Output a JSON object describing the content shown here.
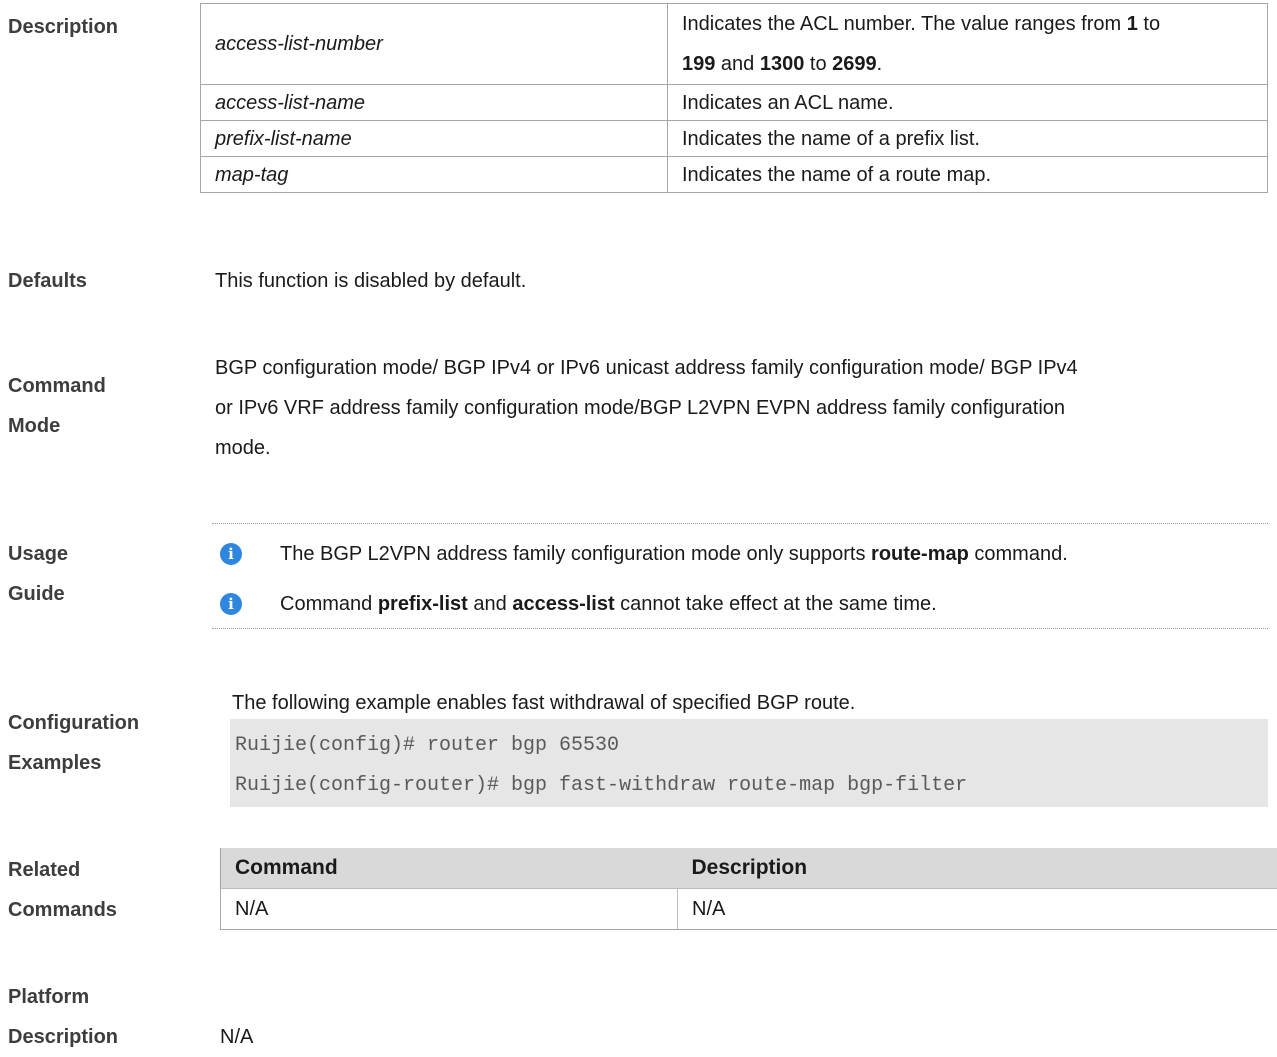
{
  "sections": {
    "description": "Description",
    "defaults": "Defaults",
    "command_mode_1": "Command",
    "command_mode_2": "Mode",
    "usage_1": "Usage",
    "usage_2": "Guide",
    "config_1": "Configuration",
    "config_2": "Examples",
    "related_1": "Related",
    "related_2": "Commands",
    "platform_1": "Platform",
    "platform_2": "Description"
  },
  "params": [
    {
      "name": "access-list-number",
      "desc_pre": "Indicates the ACL number. The value ranges from ",
      "v1": "1",
      "t1": " to",
      "v2": "199",
      "t2": " and ",
      "v3": "1300",
      "t3": " to ",
      "v4": "2699",
      "t4": "."
    },
    {
      "name": "access-list-name",
      "desc": "Indicates an ACL name."
    },
    {
      "name": "prefix-list-name",
      "desc": "Indicates the name of a prefix list."
    },
    {
      "name": "map-tag",
      "desc": "Indicates the name of a route map."
    }
  ],
  "defaults": "This function is disabled by default.",
  "command_mode": {
    "line1": "BGP configuration mode/ BGP IPv4 or IPv6 unicast address family configuration mode/ BGP IPv4",
    "line2": "or IPv6 VRF address family configuration mode/BGP L2VPN EVPN address family configuration",
    "line3": "mode."
  },
  "usage": {
    "note1_pre": "The BGP L2VPN address family configuration mode only supports ",
    "note1_kw": "route-map",
    "note1_post": " command.",
    "note2_pre": "Command ",
    "note2_kw1": "prefix-list",
    "note2_mid": " and ",
    "note2_kw2": "access-list",
    "note2_post": " cannot take effect at the same time.",
    "icon": "info-icon"
  },
  "config": {
    "intro": "The following example enables fast withdrawal of specified BGP route.",
    "code": [
      "Ruijie(config)# router bgp 65530",
      "Ruijie(config-router)# bgp fast-withdraw route-map bgp-filter"
    ]
  },
  "related": {
    "headers": [
      "Command",
      "Description"
    ],
    "rows": [
      [
        "N/A",
        "N/A"
      ]
    ]
  },
  "platform": "N/A"
}
